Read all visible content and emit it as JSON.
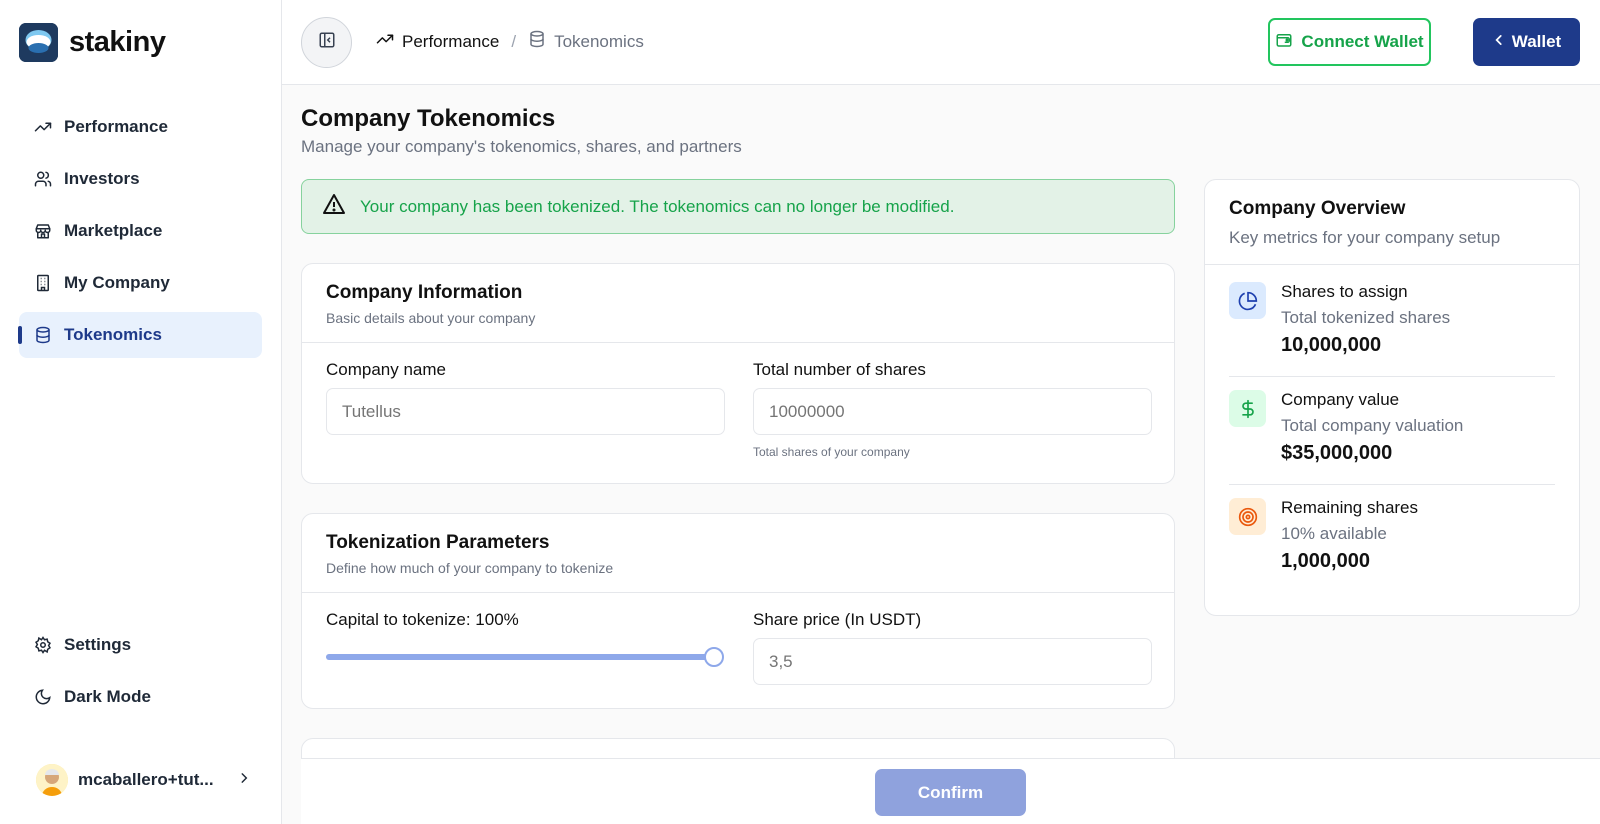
{
  "brand": {
    "name": "stakiny"
  },
  "sidebar": {
    "items": [
      {
        "label": "Performance",
        "icon": "trending-up-icon"
      },
      {
        "label": "Investors",
        "icon": "users-icon"
      },
      {
        "label": "Marketplace",
        "icon": "store-icon"
      },
      {
        "label": "My Company",
        "icon": "building-icon"
      },
      {
        "label": "Tokenomics",
        "icon": "database-icon",
        "active": true
      }
    ],
    "bottom": [
      {
        "label": "Settings",
        "icon": "gear-icon"
      },
      {
        "label": "Dark Mode",
        "icon": "moon-icon"
      }
    ],
    "user": {
      "name": "mcaballero+tut..."
    }
  },
  "header": {
    "breadcrumb": [
      "Performance",
      "Tokenomics"
    ],
    "breadcrumb_sep": "/",
    "connect_label": "Connect Wallet",
    "wallet_label": "Wallet"
  },
  "page": {
    "title": "Company Tokenomics",
    "subtitle": "Manage your company's tokenomics, shares, and partners",
    "alert": "Your company has been tokenized. The tokenomics can no longer be modified."
  },
  "company_info": {
    "title": "Company Information",
    "subtitle": "Basic details about your company",
    "name_label": "Company name",
    "name_value": "Tutellus",
    "shares_label": "Total number of shares",
    "shares_value": "10000000",
    "shares_hint": "Total shares of your company"
  },
  "tokenization": {
    "title": "Tokenization Parameters",
    "subtitle": "Define how much of your company to tokenize",
    "capital_label": "Capital to tokenize: 100%",
    "capital_fraction": 1.0,
    "price_label": "Share price (In USDT)",
    "price_value": "3,5"
  },
  "overview": {
    "title": "Company Overview",
    "subtitle": "Key metrics for your company setup",
    "metrics": [
      {
        "name": "Shares to assign",
        "desc": "Total tokenized shares",
        "value": "10,000,000",
        "icon": "pie-chart-icon",
        "color": "#1e40af",
        "bg": "#dbeafe"
      },
      {
        "name": "Company value",
        "desc": "Total company valuation",
        "value": "$35,000,000",
        "icon": "dollar-icon",
        "color": "#16a34a",
        "bg": "#dcfce7"
      },
      {
        "name": "Remaining shares",
        "desc": "10% available",
        "value": "1,000,000",
        "icon": "target-icon",
        "color": "#ea580c",
        "bg": "#ffedd5"
      }
    ]
  },
  "footer": {
    "confirm_label": "Confirm"
  }
}
